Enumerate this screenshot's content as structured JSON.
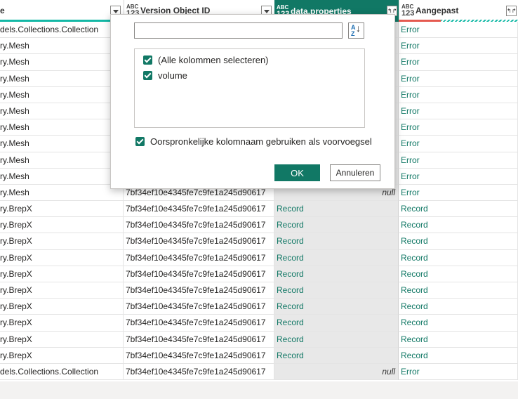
{
  "columns": [
    {
      "type_top": "",
      "type_bottom": "",
      "title": "e"
    },
    {
      "type_top": "ABC",
      "type_bottom": "123",
      "title": "Version Object ID"
    },
    {
      "type_top": "ABC",
      "type_bottom": "123",
      "title": "data.properties"
    },
    {
      "type_top": "ABC",
      "type_bottom": "123",
      "title": "Aangepast"
    }
  ],
  "colors": {
    "accent": "#117865",
    "quality_ok": "#14b8a6",
    "quality_err": "#e55a50"
  },
  "rows": [
    [
      "dels.Collections.Collection",
      "",
      "",
      "Error"
    ],
    [
      "ry.Mesh",
      "",
      "",
      "Error"
    ],
    [
      "ry.Mesh",
      "",
      "",
      "Error"
    ],
    [
      "ry.Mesh",
      "",
      "",
      "Error"
    ],
    [
      "ry.Mesh",
      "",
      "",
      "Error"
    ],
    [
      "ry.Mesh",
      "",
      "",
      "Error"
    ],
    [
      "ry.Mesh",
      "",
      "",
      "Error"
    ],
    [
      "ry.Mesh",
      "",
      "",
      "Error"
    ],
    [
      "ry.Mesh",
      "",
      "",
      "Error"
    ],
    [
      "ry.Mesh",
      "",
      "",
      "Error"
    ],
    [
      "ry.Mesh",
      "7bf34ef10e4345fe7c9fe1a245d90617",
      "null",
      "Error"
    ],
    [
      "ry.BrepX",
      "7bf34ef10e4345fe7c9fe1a245d90617",
      "Record",
      "Record"
    ],
    [
      "ry.BrepX",
      "7bf34ef10e4345fe7c9fe1a245d90617",
      "Record",
      "Record"
    ],
    [
      "ry.BrepX",
      "7bf34ef10e4345fe7c9fe1a245d90617",
      "Record",
      "Record"
    ],
    [
      "ry.BrepX",
      "7bf34ef10e4345fe7c9fe1a245d90617",
      "Record",
      "Record"
    ],
    [
      "ry.BrepX",
      "7bf34ef10e4345fe7c9fe1a245d90617",
      "Record",
      "Record"
    ],
    [
      "ry.BrepX",
      "7bf34ef10e4345fe7c9fe1a245d90617",
      "Record",
      "Record"
    ],
    [
      "ry.BrepX",
      "7bf34ef10e4345fe7c9fe1a245d90617",
      "Record",
      "Record"
    ],
    [
      "ry.BrepX",
      "7bf34ef10e4345fe7c9fe1a245d90617",
      "Record",
      "Record"
    ],
    [
      "ry.BrepX",
      "7bf34ef10e4345fe7c9fe1a245d90617",
      "Record",
      "Record"
    ],
    [
      "ry.BrepX",
      "7bf34ef10e4345fe7c9fe1a245d90617",
      "Record",
      "Record"
    ],
    [
      "dels.Collections.Collection",
      "7bf34ef10e4345fe7c9fe1a245d90617",
      "null",
      "Error"
    ]
  ],
  "popup": {
    "search_value": "",
    "sort_icon": "sort-az-icon",
    "sort_label": "AZ",
    "options": [
      {
        "label": "(Alle kolommen selecteren)",
        "checked": true
      },
      {
        "label": "volume",
        "checked": true
      }
    ],
    "prefix_label": "Oorspronkelijke kolomnaam gebruiken als voorvoegsel",
    "ok_label": "OK",
    "cancel_label": "Annuleren"
  }
}
